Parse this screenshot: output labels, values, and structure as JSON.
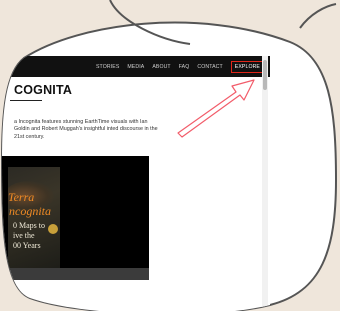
{
  "nav": {
    "items": [
      "STORIES",
      "MEDIA",
      "ABOUT",
      "FAQ",
      "CONTACT"
    ],
    "explore": "EXPLORE"
  },
  "page": {
    "title": "COGNITA",
    "description": "a Incognita features stunning EarthTime visuals with Ian Goldin and Robert Muggah's insightful inted discourse in the 21st century."
  },
  "book": {
    "line1": "Terra",
    "line2": "ncognita",
    "line3a": "0 Maps to",
    "line3b": "ive the",
    "line3c": "00 Years"
  },
  "colors": {
    "background": "#efe6db",
    "topbar": "#111111",
    "highlight": "#e0261a",
    "arrow": "#f25c6a"
  },
  "icons": {
    "arrow": "pointer-arrow-icon"
  }
}
